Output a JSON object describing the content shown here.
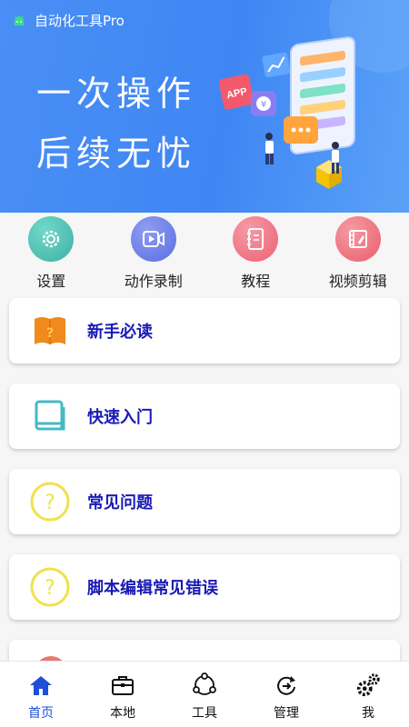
{
  "app": {
    "title": "自动化工具Pro"
  },
  "banner": {
    "line1": "一次操作",
    "line2": "后续无忧",
    "art_text": "APP"
  },
  "quick": [
    {
      "label": "设置",
      "icon": "gear-icon",
      "color": "#4fc3b5"
    },
    {
      "label": "动作录制",
      "icon": "video-record-icon",
      "color": "#6b7ee6"
    },
    {
      "label": "教程",
      "icon": "notebook-icon",
      "color": "#f06f7e"
    },
    {
      "label": "视频剪辑",
      "icon": "film-edit-icon",
      "color": "#ef6e78"
    }
  ],
  "cards": [
    {
      "label": "新手必读",
      "icon": "question-book-icon"
    },
    {
      "label": "快速入门",
      "icon": "book-icon"
    },
    {
      "label": "常见问题",
      "icon": "question-circle-icon"
    },
    {
      "label": "脚本编辑常见错误",
      "icon": "question-circle-icon"
    }
  ],
  "nav": [
    {
      "label": "首页",
      "icon": "home-icon",
      "active": true
    },
    {
      "label": "本地",
      "icon": "briefcase-icon"
    },
    {
      "label": "工具",
      "icon": "share-nodes-icon"
    },
    {
      "label": "管理",
      "icon": "refresh-icon"
    },
    {
      "label": "我",
      "icon": "gears-icon"
    }
  ],
  "colors": {
    "accent": "#1e4fd6",
    "card_title": "#1a1ab5",
    "banner": "#4a8ff5",
    "yellow": "#f0e24a"
  }
}
